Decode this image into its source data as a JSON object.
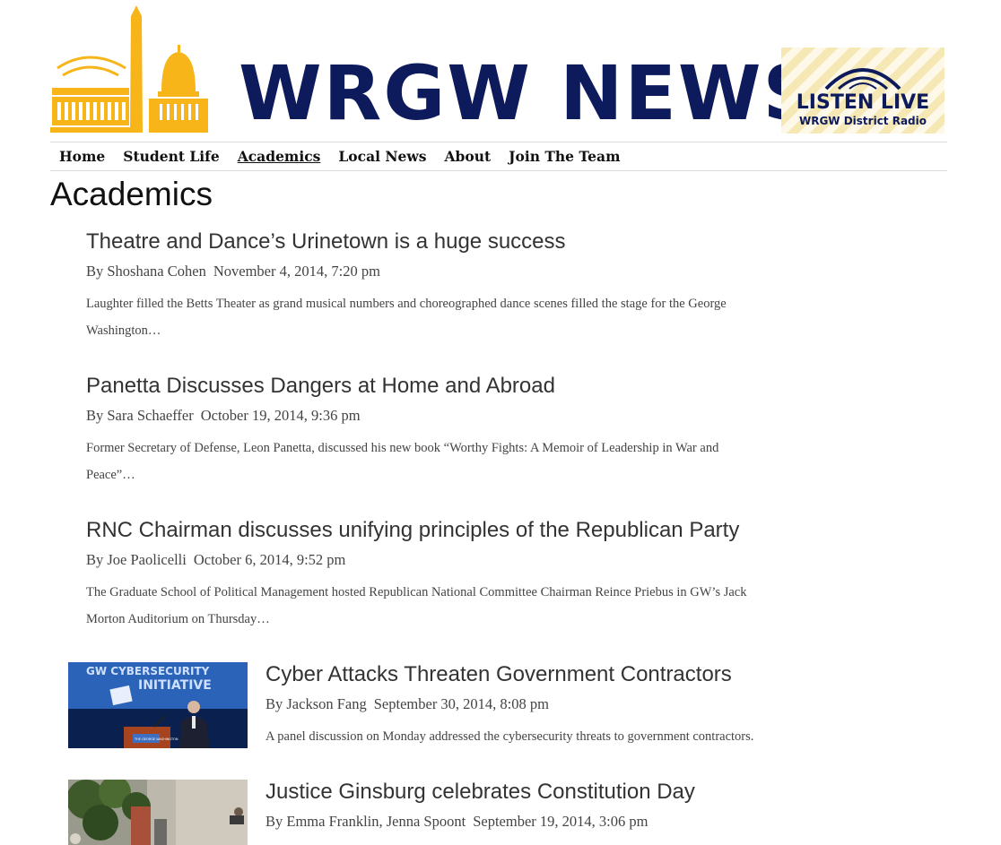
{
  "header": {
    "logo_text": "WRGW NEWS",
    "listen_live": {
      "title": "LISTEN LIVE",
      "subtitle": "WRGW District Radio"
    }
  },
  "nav": {
    "items": [
      {
        "label": "Home"
      },
      {
        "label": "Student Life"
      },
      {
        "label": "Academics"
      },
      {
        "label": "Local News"
      },
      {
        "label": "About"
      },
      {
        "label": "Join The Team"
      }
    ],
    "active": "Academics"
  },
  "page": {
    "title": "Academics"
  },
  "articles": [
    {
      "title": "Theatre and Dance’s Urinetown is a huge success",
      "author": "By Shoshana Cohen",
      "date": "November 4, 2014, 7:20 pm",
      "excerpt": "Laughter filled the Betts Theater as grand musical numbers and choreographed dance scenes filled the stage for the George Washington…"
    },
    {
      "title": "Panetta Discusses Dangers at Home and Abroad",
      "author": "By Sara Schaeffer",
      "date": "October 19, 2014, 9:36 pm",
      "excerpt": "Former Secretary of Defense, Leon Panetta, discussed his new book “Worthy Fights: A Memoir of Leadership in War and Peace”…"
    },
    {
      "title": "RNC Chairman discusses unifying principles of the Republican Party",
      "author": "By Joe Paolicelli",
      "date": "October 6, 2014, 9:52 pm",
      "excerpt": "The Graduate School of Political Management hosted Republican National Committee Chairman Reince Priebus in GW’s Jack Morton Auditorium on Thursday…"
    },
    {
      "title": "Cyber Attacks Threaten Government Contractors",
      "author": "By Jackson Fang",
      "date": "September 30, 2014, 8:08 pm",
      "excerpt": "A panel discussion on Monday addressed the cybersecurity threats to government contractors.",
      "thumb_text": {
        "line1": "GW CYBERSECURITY",
        "line2": "INITIATIVE",
        "podium": "THE GEORGE WASHINGTON"
      }
    },
    {
      "title": "Justice Ginsburg celebrates Constitution Day",
      "author": "By Emma Franklin, Jenna Spoont",
      "date": "September 19, 2014, 3:06 pm"
    }
  ],
  "colors": {
    "brand_navy": "#0d1a5c",
    "brand_gold": "#f7b519",
    "text": "#333333"
  }
}
